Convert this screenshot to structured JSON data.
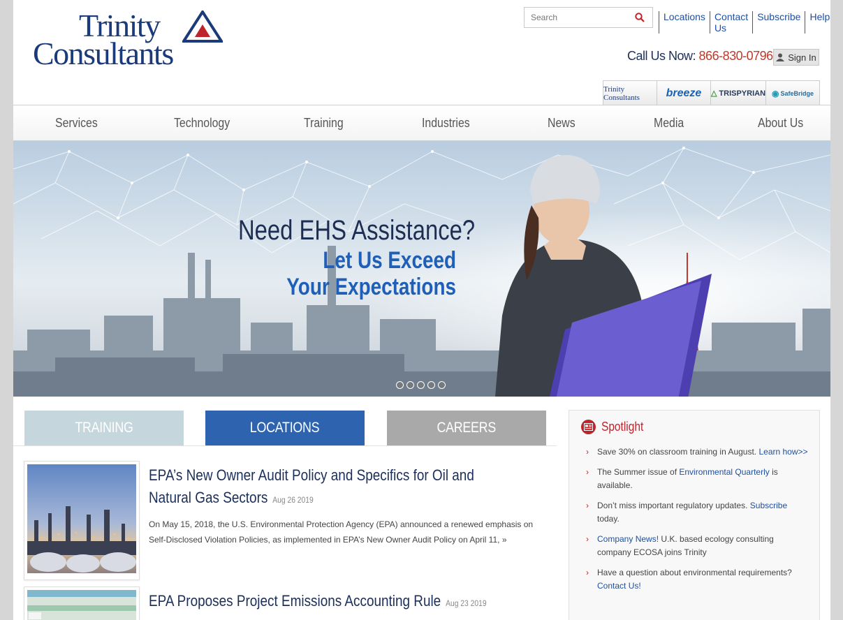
{
  "header": {
    "logo_line1": "Trinity",
    "logo_line2": "Consultants",
    "search_placeholder": "Search",
    "top_links": [
      "Locations",
      "Contact Us",
      "Subscribe",
      "Help"
    ],
    "call_label": "Call Us Now:",
    "phone": "866-830-0796",
    "signin_label": "Sign In",
    "brands": [
      "Trinity Consultants",
      "breeze",
      "TRISPYRIAN",
      "SafeBridge"
    ]
  },
  "nav": {
    "items": [
      "Services",
      "Technology",
      "Training",
      "Industries",
      "News",
      "Media",
      "About Us"
    ]
  },
  "hero": {
    "headline": "Need EHS Assistance?",
    "sub_line1": "Let Us Exceed",
    "sub_line2": "Your Expectations",
    "slide_count": 5
  },
  "quick_tabs": {
    "training": "TRAINING",
    "locations": "LOCATIONS",
    "careers": "CAREERS"
  },
  "articles": [
    {
      "title": "EPA’s New Owner Audit Policy and Specifics for Oil and Natural Gas Sectors",
      "date": "Aug 26 2019",
      "body": "On May 15, 2018, the U.S. Environmental Protection Agency (EPA) announced a renewed emphasis on Self-Disclosed Violation Policies, as implemented in EPA’s New Owner Audit Policy on April 11,",
      "more": "»"
    },
    {
      "title": "EPA Proposes Project Emissions Accounting Rule",
      "date": "Aug 23 2019"
    }
  ],
  "spotlight": {
    "title": "Spotlight",
    "items": [
      {
        "pre": "Save 30% on classroom training in August. ",
        "link": "Learn how>>",
        "post": ""
      },
      {
        "pre": "The Summer issue of ",
        "link": "Environmental Quarterly",
        "post": " is available."
      },
      {
        "pre": "Don’t miss important regulatory updates. ",
        "link": "Subscribe",
        "post": " today."
      },
      {
        "pre": "",
        "link": "Company News!",
        "post": " U.K. based ecology consulting company ECOSA joins Trinity"
      },
      {
        "pre": "Have a question about environmental requirements? ",
        "link": "Contact Us!",
        "post": ""
      }
    ]
  },
  "colors": {
    "brand_navy": "#1b3a7a",
    "link_blue": "#1f4fa0",
    "phone_red": "#c0392b",
    "tab_training": "#c5d6dd",
    "tab_locations": "#2e63b0",
    "tab_careers": "#a9a9a9",
    "spotlight_red": "#c0242b"
  }
}
